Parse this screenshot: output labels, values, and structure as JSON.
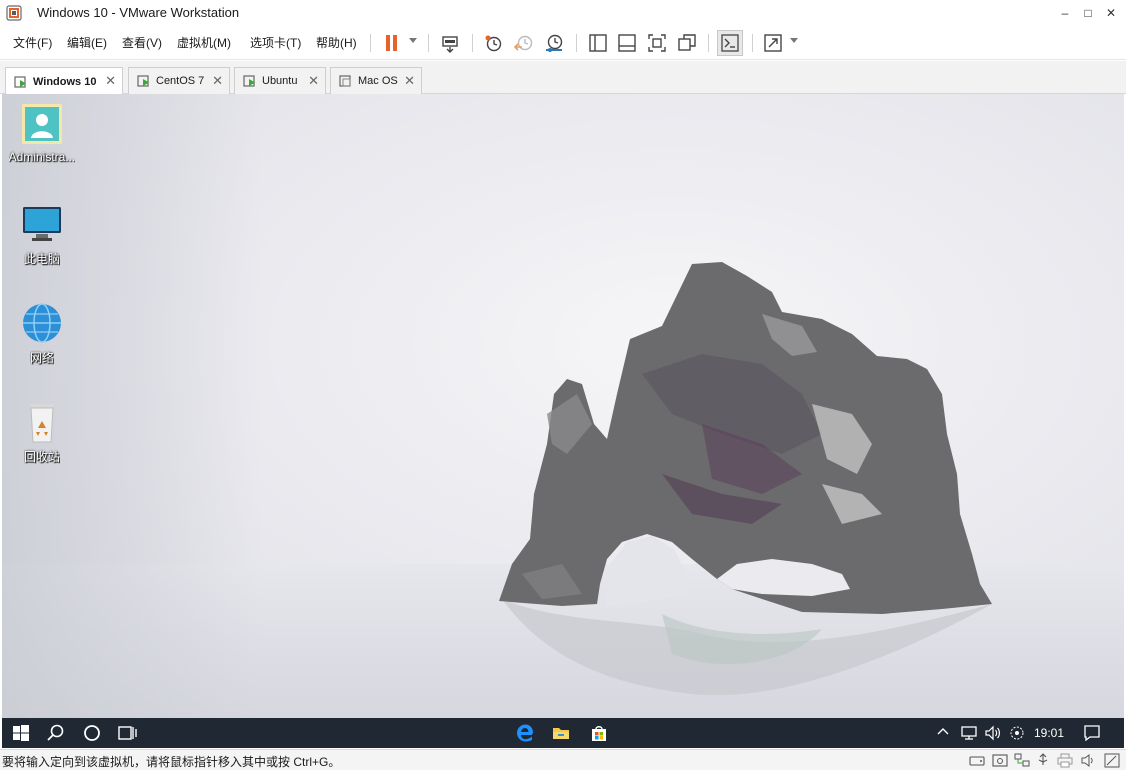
{
  "window": {
    "title": "Windows 10 - VMware Workstation",
    "minimize": "–",
    "maximize": "□",
    "close": "✕"
  },
  "menu": {
    "items": [
      "文件(F)",
      "编辑(E)",
      "查看(V)",
      "虚拟机(M)",
      "选项卡(T)",
      "帮助(H)"
    ]
  },
  "toolbar": {
    "icons": [
      "pause-icon",
      "send-ctrl-alt-del-icon",
      "snapshot-take-icon",
      "snapshot-revert-icon",
      "snapshot-manager-icon",
      "sidebar-toggle-icon",
      "thumbnail-bar-icon",
      "full-screen-icon",
      "unity-icon",
      "console-view-icon",
      "stretch-guest-icon"
    ],
    "accent": "#e8632b"
  },
  "tabs": [
    {
      "label": "Windows 10",
      "active": true,
      "close": "✕"
    },
    {
      "label": "CentOS 7",
      "active": false,
      "close": "✕"
    },
    {
      "label": "Ubuntu",
      "active": false,
      "close": "✕"
    },
    {
      "label": "Mac OS",
      "active": false,
      "close": "✕"
    }
  ],
  "desktop": {
    "icons": [
      {
        "label": "Administra...",
        "icon": "user-folder-icon"
      },
      {
        "label": "此电脑",
        "icon": "this-pc-icon"
      },
      {
        "label": "网络",
        "icon": "network-icon"
      },
      {
        "label": "回收站",
        "icon": "recycle-bin-icon"
      }
    ]
  },
  "taskbar": {
    "time": "19:01",
    "icons": [
      "start-icon",
      "search-icon",
      "cortana-icon",
      "task-view-icon",
      "edge-icon",
      "file-explorer-icon",
      "store-icon",
      "tray-chevron-icon",
      "network-tray-icon",
      "volume-icon",
      "input-method-icon",
      "action-center-icon"
    ],
    "background": "#1f2833"
  },
  "statusbar": {
    "text": "要将输入定向到该虚拟机，请将鼠标指针移入其中或按 Ctrl+G。",
    "icons": [
      "hdd-status-icon",
      "cdrom-status-icon",
      "network-status-icon",
      "usb-status-icon",
      "printer-status-icon",
      "sound-status-icon",
      "message-status-icon"
    ]
  }
}
